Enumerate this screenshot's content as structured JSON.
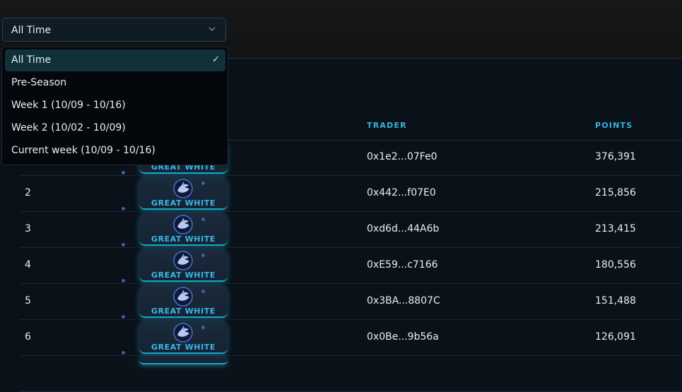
{
  "filter": {
    "selected": "All Time",
    "options": [
      {
        "label": "All Time",
        "active": true
      },
      {
        "label": "Pre-Season",
        "active": false
      },
      {
        "label": "Week 1 (10/09 - 10/16)",
        "active": false
      },
      {
        "label": "Week 2 (10/02 - 10/09)",
        "active": false
      },
      {
        "label": "Current week (10/09 - 10/16)",
        "active": false
      }
    ],
    "check_glyph": "✓"
  },
  "table": {
    "headers": {
      "trader": "TRADER",
      "points": "POINTS"
    },
    "rows": [
      {
        "rank": "",
        "badge": "GREAT WHITE",
        "trader": "0x1e2...07Fe0",
        "points": "376,391"
      },
      {
        "rank": "2",
        "badge": "GREAT WHITE",
        "trader": "0x442...f07E0",
        "points": "215,856"
      },
      {
        "rank": "3",
        "badge": "GREAT WHITE",
        "trader": "0xd6d...44A6b",
        "points": "213,415"
      },
      {
        "rank": "4",
        "badge": "GREAT WHITE",
        "trader": "0xE59...c7166",
        "points": "180,556"
      },
      {
        "rank": "5",
        "badge": "GREAT WHITE",
        "trader": "0x3BA...8807C",
        "points": "151,488"
      },
      {
        "rank": "6",
        "badge": "GREAT WHITE",
        "trader": "0x0Be...9b56a",
        "points": "126,091"
      },
      {
        "rank": "",
        "badge": "",
        "trader": "",
        "points": ""
      }
    ]
  },
  "icons": {
    "dropdown": "chevron-down-icon",
    "badge": "shark-icon",
    "selected": "check-icon"
  },
  "colors": {
    "accent": "#2fb6df",
    "badge_text": "#3ab7e8",
    "selected_bg": "#10303a"
  }
}
